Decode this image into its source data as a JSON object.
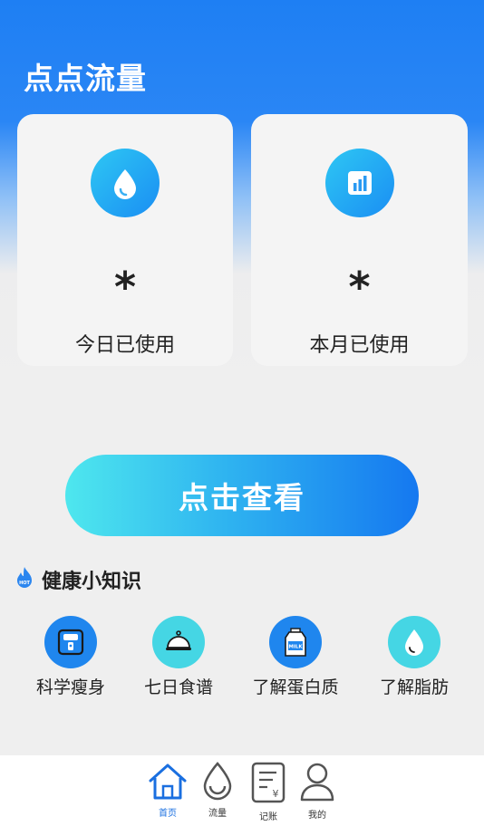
{
  "app": {
    "title": "点点流量"
  },
  "cards": [
    {
      "value": "*",
      "label": "今日已使用",
      "icon": "water-drop-icon"
    },
    {
      "value": "*",
      "label": "本月已使用",
      "icon": "bar-chart-icon"
    }
  ],
  "cta": {
    "label": "点击查看"
  },
  "health": {
    "title": "健康小知识",
    "badge_icon": "hot-flame-icon",
    "items": [
      {
        "label": "科学瘦身",
        "icon": "scale-icon",
        "color": "#1f86ee"
      },
      {
        "label": "七日食谱",
        "icon": "food-cloche-icon",
        "color": "#45d6e4"
      },
      {
        "label": "了解蛋白质",
        "icon": "milk-carton-icon",
        "color": "#1f86ee"
      },
      {
        "label": "了解脂肪",
        "icon": "oil-drop-icon",
        "color": "#45d6e4"
      }
    ]
  },
  "tabbar": {
    "items": [
      {
        "label": "首页",
        "icon": "home-icon",
        "active": true
      },
      {
        "label": "流量",
        "icon": "traffic-drop-icon",
        "active": false
      },
      {
        "label": "记账",
        "icon": "ledger-icon",
        "active": false
      },
      {
        "label": "我的",
        "icon": "user-icon",
        "active": false
      }
    ]
  },
  "colors": {
    "primary": "#1e7ff3",
    "accent": "#45d6e4",
    "active_tab": "#1a6fe0"
  }
}
